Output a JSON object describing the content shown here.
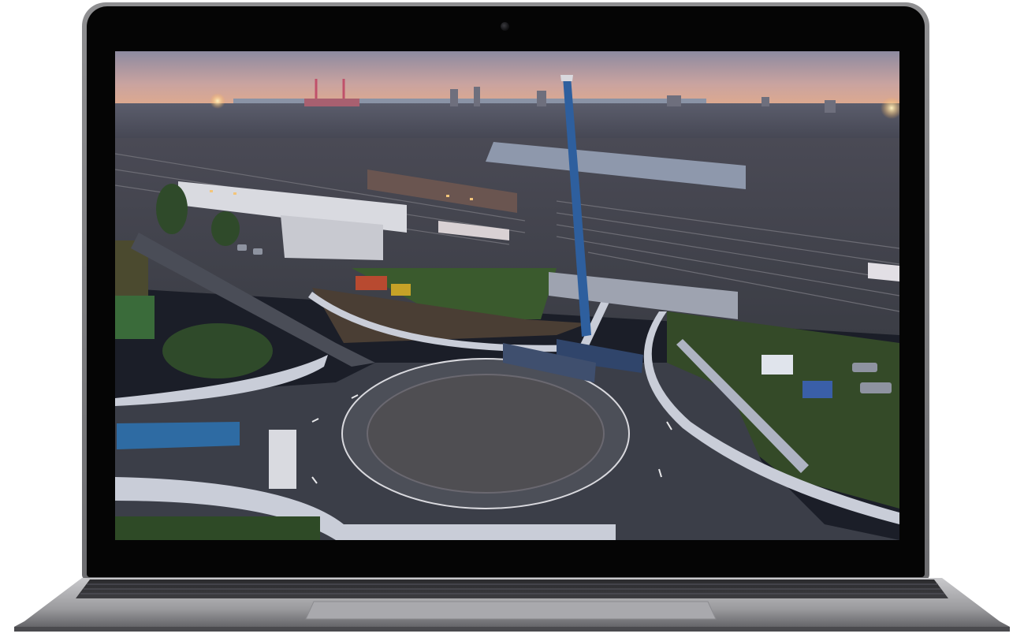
{
  "device": {
    "type": "laptop",
    "screen_content": "aerial-photo"
  },
  "colors": {
    "bezel": "#050505",
    "chassis": "#8a8a8d",
    "sky_top": "#8d8aa0",
    "sky_horizon": "#e3ab8a",
    "road": "#3b3e48",
    "crane": "#2e5f9e",
    "grass": "#3c5a2c",
    "wall": "#c9cdd8"
  }
}
